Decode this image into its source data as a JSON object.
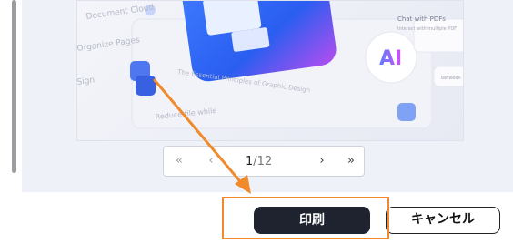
{
  "preview": {
    "sidebar_labels": [
      "Document Cloud",
      "Organize Pages",
      "Sign",
      "Reduce file while"
    ],
    "caption": "The Essential Principles of Graphic Design",
    "chat_title": "Chat with PDFs",
    "chat_sub": "Interact with multiple PDF",
    "ai_badge": "AI",
    "right_label": "between"
  },
  "pager": {
    "first_icon": "«",
    "prev_icon": "‹",
    "current_page": "1",
    "separator": "/",
    "total_pages": "12",
    "next_icon": "›",
    "last_icon": "»"
  },
  "actions": {
    "print_label": "印刷",
    "cancel_label": "キャンセル"
  },
  "colors": {
    "annotation": "#f08a2b",
    "primary_button": "#1f2330",
    "panel_bg": "#eef1f8"
  }
}
